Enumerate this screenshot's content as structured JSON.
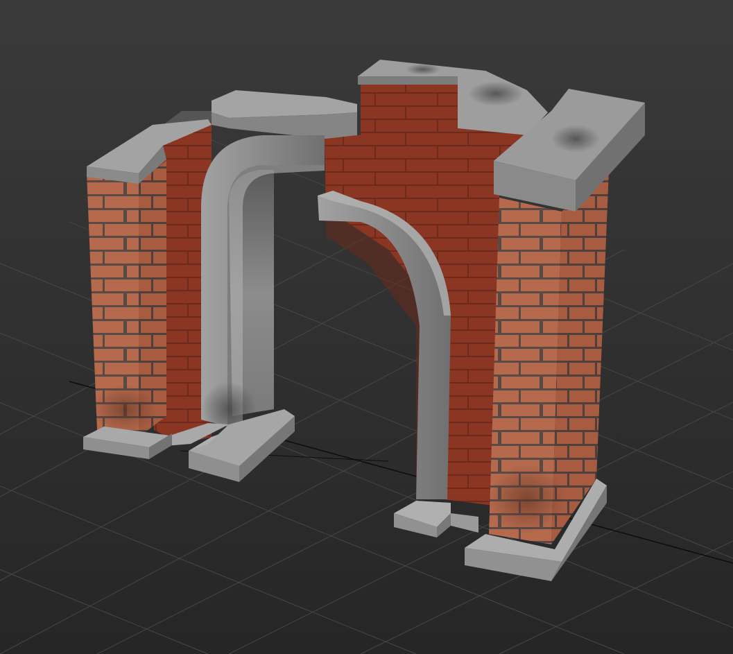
{
  "viewport": {
    "background_top": "#3a3a3a",
    "background_bottom": "#262626",
    "grid_color": "#4a4a4a",
    "axis_color": "#0a0a0a"
  },
  "model": {
    "name": "brick-archway",
    "brick_color": "#b5694d",
    "brick_dark_color": "#7a2f1f",
    "mortar_color": "#5a4a46",
    "stone_color": "#a8a8a8",
    "stone_dark_color": "#6e6e6e"
  }
}
